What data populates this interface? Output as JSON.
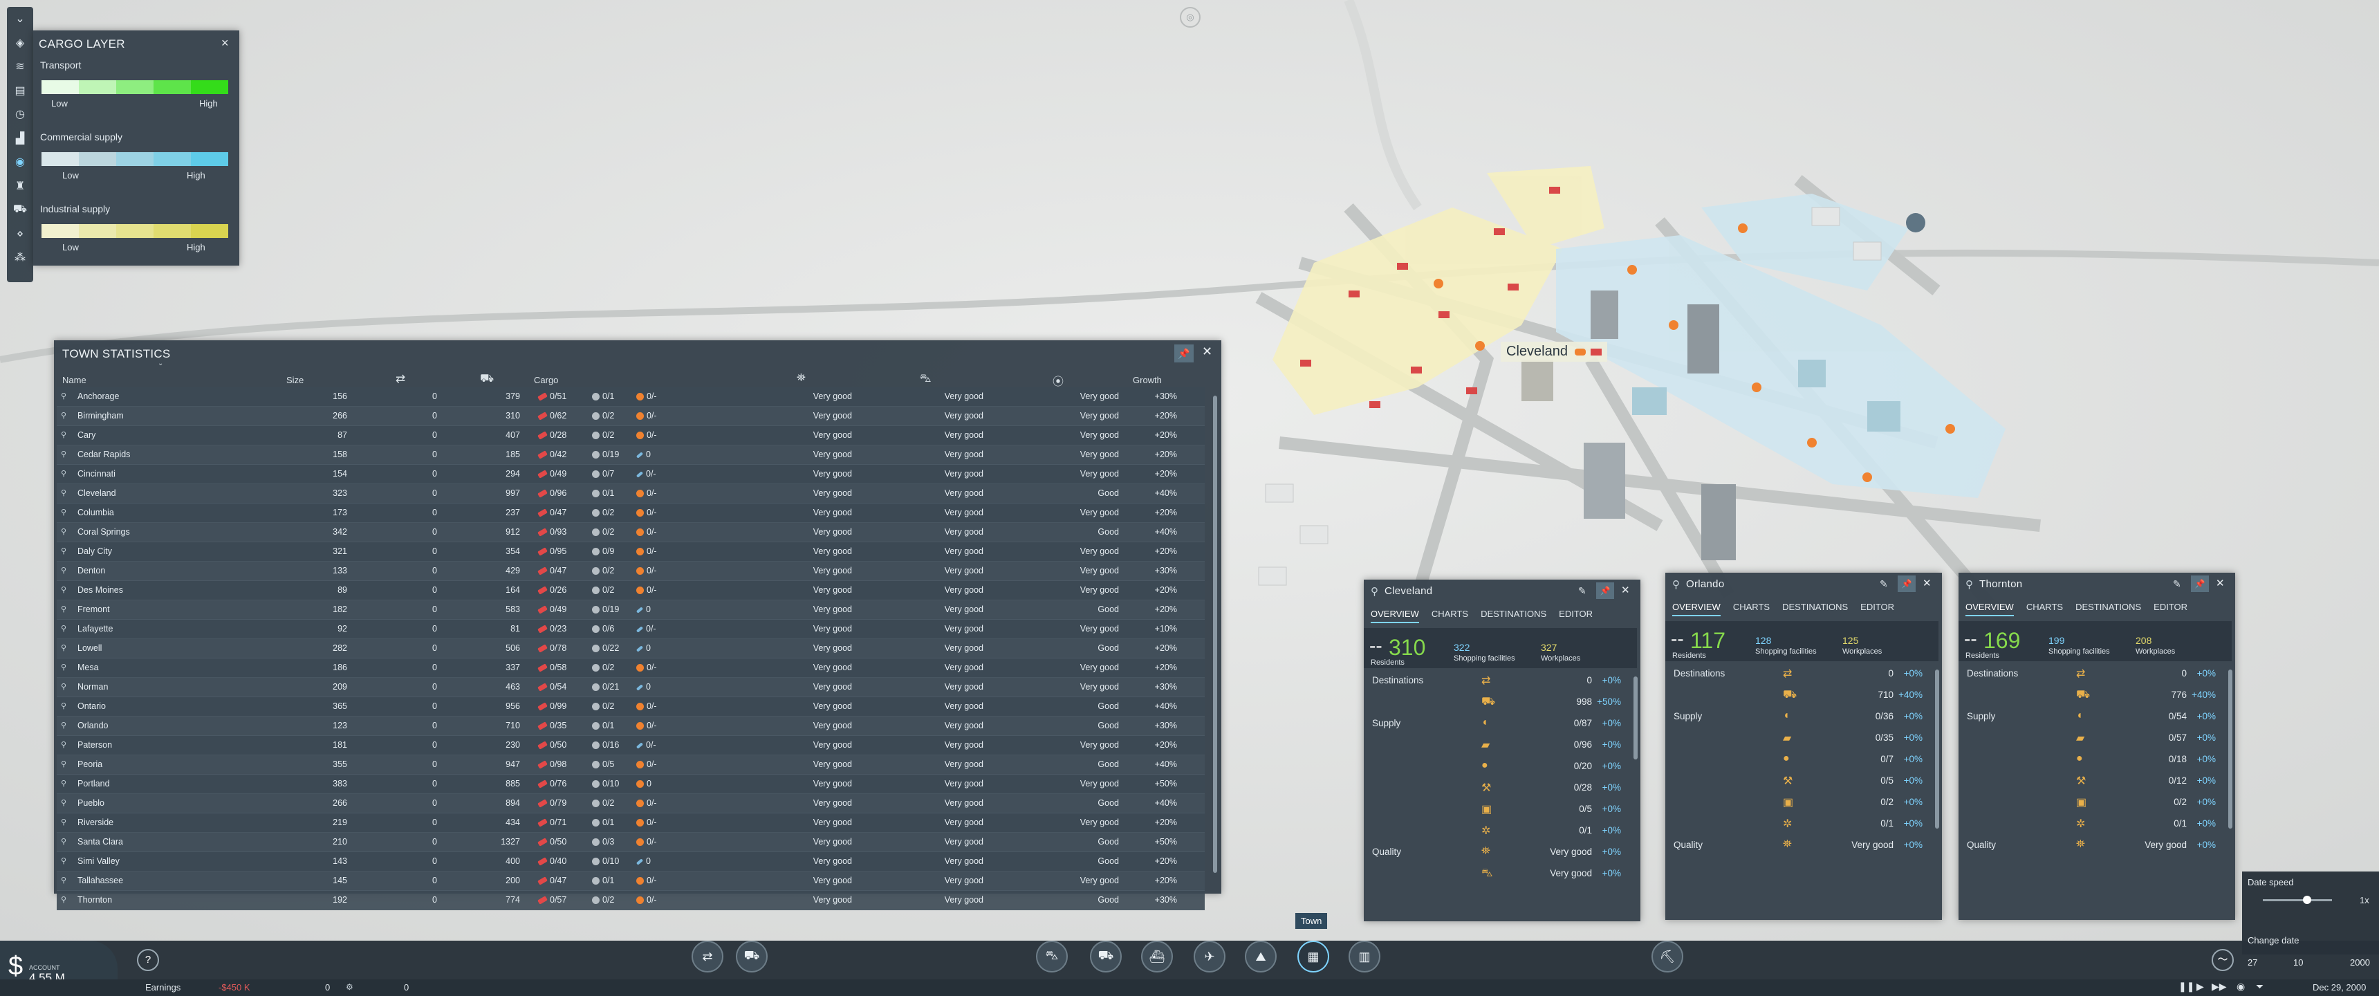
{
  "cargo_layer": {
    "title": "CARGO LAYER",
    "close": "×",
    "sections": [
      {
        "label": "Transport",
        "low": "Low",
        "high": "High",
        "colors": [
          "#e8fbe6",
          "#bff5b6",
          "#8eed80",
          "#5ee44a",
          "#34dc1a"
        ]
      },
      {
        "label": "Commercial supply",
        "low": "Low",
        "high": "High",
        "colors": [
          "#d9e6ea",
          "#bcd6de",
          "#9dd3e3",
          "#7fd0e6",
          "#5ecbe8"
        ]
      },
      {
        "label": "Industrial supply",
        "low": "Low",
        "high": "High",
        "colors": [
          "#f2f1cf",
          "#ebe9ad",
          "#e6e38f",
          "#e0dc70",
          "#d9d450"
        ]
      }
    ]
  },
  "town_stats": {
    "title": "TOWN STATISTICS",
    "columns": {
      "name": "Name",
      "size": "Size",
      "cargo": "Cargo",
      "growth": "Growth"
    },
    "rows": [
      {
        "name": "Anchorage",
        "size": "156",
        "a": "0",
        "b": "379",
        "c1": "0/51",
        "c2": "0/1",
        "c3": "0/-",
        "icon3": "orange",
        "q1": "Very good",
        "q2": "Very good",
        "q3": "Very good",
        "growth": "+30%"
      },
      {
        "name": "Birmingham",
        "size": "266",
        "a": "0",
        "b": "310",
        "c1": "0/62",
        "c2": "0/2",
        "c3": "0/-",
        "icon3": "orange",
        "q1": "Very good",
        "q2": "Very good",
        "q3": "Very good",
        "growth": "+20%"
      },
      {
        "name": "Cary",
        "size": "87",
        "a": "0",
        "b": "407",
        "c1": "0/28",
        "c2": "0/2",
        "c3": "0/-",
        "icon3": "orange",
        "q1": "Very good",
        "q2": "Very good",
        "q3": "Very good",
        "growth": "+20%"
      },
      {
        "name": "Cedar Rapids",
        "size": "158",
        "a": "0",
        "b": "185",
        "c1": "0/42",
        "c2": "0/19",
        "c3": "0",
        "icon3": "tool",
        "q1": "Very good",
        "q2": "Very good",
        "q3": "Very good",
        "growth": "+20%"
      },
      {
        "name": "Cincinnati",
        "size": "154",
        "a": "0",
        "b": "294",
        "c1": "0/49",
        "c2": "0/7",
        "c3": "0/-",
        "icon3": "tool",
        "q1": "Very good",
        "q2": "Very good",
        "q3": "Very good",
        "growth": "+20%"
      },
      {
        "name": "Cleveland",
        "size": "323",
        "a": "0",
        "b": "997",
        "c1": "0/96",
        "c2": "0/1",
        "c3": "0/-",
        "icon3": "orange",
        "q1": "Very good",
        "q2": "Very good",
        "q3": "Good",
        "growth": "+40%"
      },
      {
        "name": "Columbia",
        "size": "173",
        "a": "0",
        "b": "237",
        "c1": "0/47",
        "c2": "0/2",
        "c3": "0/-",
        "icon3": "orange",
        "q1": "Very good",
        "q2": "Very good",
        "q3": "Very good",
        "growth": "+20%"
      },
      {
        "name": "Coral Springs",
        "size": "342",
        "a": "0",
        "b": "912",
        "c1": "0/93",
        "c2": "0/2",
        "c3": "0/-",
        "icon3": "orange",
        "q1": "Very good",
        "q2": "Very good",
        "q3": "Good",
        "growth": "+40%"
      },
      {
        "name": "Daly City",
        "size": "321",
        "a": "0",
        "b": "354",
        "c1": "0/95",
        "c2": "0/9",
        "c3": "0/-",
        "icon3": "orange",
        "q1": "Very good",
        "q2": "Very good",
        "q3": "Very good",
        "growth": "+20%"
      },
      {
        "name": "Denton",
        "size": "133",
        "a": "0",
        "b": "429",
        "c1": "0/47",
        "c2": "0/2",
        "c3": "0/-",
        "icon3": "orange",
        "q1": "Very good",
        "q2": "Very good",
        "q3": "Very good",
        "growth": "+30%"
      },
      {
        "name": "Des Moines",
        "size": "89",
        "a": "0",
        "b": "164",
        "c1": "0/26",
        "c2": "0/2",
        "c3": "0/-",
        "icon3": "orange",
        "q1": "Very good",
        "q2": "Very good",
        "q3": "Very good",
        "growth": "+20%"
      },
      {
        "name": "Fremont",
        "size": "182",
        "a": "0",
        "b": "583",
        "c1": "0/49",
        "c2": "0/19",
        "c3": "0",
        "icon3": "tool",
        "q1": "Very good",
        "q2": "Very good",
        "q3": "Good",
        "growth": "+20%"
      },
      {
        "name": "Lafayette",
        "size": "92",
        "a": "0",
        "b": "81",
        "c1": "0/23",
        "c2": "0/6",
        "c3": "0/-",
        "icon3": "tool",
        "q1": "Very good",
        "q2": "Very good",
        "q3": "Very good",
        "growth": "+10%"
      },
      {
        "name": "Lowell",
        "size": "282",
        "a": "0",
        "b": "506",
        "c1": "0/78",
        "c2": "0/22",
        "c3": "0",
        "icon3": "tool",
        "q1": "Very good",
        "q2": "Very good",
        "q3": "Good",
        "growth": "+20%"
      },
      {
        "name": "Mesa",
        "size": "186",
        "a": "0",
        "b": "337",
        "c1": "0/58",
        "c2": "0/2",
        "c3": "0/-",
        "icon3": "orange",
        "q1": "Very good",
        "q2": "Very good",
        "q3": "Very good",
        "growth": "+20%"
      },
      {
        "name": "Norman",
        "size": "209",
        "a": "0",
        "b": "463",
        "c1": "0/54",
        "c2": "0/21",
        "c3": "0",
        "icon3": "tool",
        "q1": "Very good",
        "q2": "Very good",
        "q3": "Very good",
        "growth": "+30%"
      },
      {
        "name": "Ontario",
        "size": "365",
        "a": "0",
        "b": "956",
        "c1": "0/99",
        "c2": "0/2",
        "c3": "0/-",
        "icon3": "orange",
        "q1": "Very good",
        "q2": "Very good",
        "q3": "Good",
        "growth": "+40%"
      },
      {
        "name": "Orlando",
        "size": "123",
        "a": "0",
        "b": "710",
        "c1": "0/35",
        "c2": "0/1",
        "c3": "0/-",
        "icon3": "orange",
        "q1": "Very good",
        "q2": "Very good",
        "q3": "Good",
        "growth": "+30%"
      },
      {
        "name": "Paterson",
        "size": "181",
        "a": "0",
        "b": "230",
        "c1": "0/50",
        "c2": "0/16",
        "c3": "0/-",
        "icon3": "tool",
        "q1": "Very good",
        "q2": "Very good",
        "q3": "Very good",
        "growth": "+20%"
      },
      {
        "name": "Peoria",
        "size": "355",
        "a": "0",
        "b": "947",
        "c1": "0/98",
        "c2": "0/5",
        "c3": "0/-",
        "icon3": "orange",
        "q1": "Very good",
        "q2": "Very good",
        "q3": "Good",
        "growth": "+40%"
      },
      {
        "name": "Portland",
        "size": "383",
        "a": "0",
        "b": "885",
        "c1": "0/76",
        "c2": "0/10",
        "c3": "0",
        "icon3": "orange",
        "q1": "Very good",
        "q2": "Very good",
        "q3": "Very good",
        "growth": "+50%"
      },
      {
        "name": "Pueblo",
        "size": "266",
        "a": "0",
        "b": "894",
        "c1": "0/79",
        "c2": "0/2",
        "c3": "0/-",
        "icon3": "orange",
        "q1": "Very good",
        "q2": "Very good",
        "q3": "Good",
        "growth": "+40%"
      },
      {
        "name": "Riverside",
        "size": "219",
        "a": "0",
        "b": "434",
        "c1": "0/71",
        "c2": "0/1",
        "c3": "0/-",
        "icon3": "orange",
        "q1": "Very good",
        "q2": "Very good",
        "q3": "Very good",
        "growth": "+20%"
      },
      {
        "name": "Santa Clara",
        "size": "210",
        "a": "0",
        "b": "1327",
        "c1": "0/50",
        "c2": "0/3",
        "c3": "0/-",
        "icon3": "orange",
        "q1": "Very good",
        "q2": "Very good",
        "q3": "Good",
        "growth": "+50%"
      },
      {
        "name": "Simi Valley",
        "size": "143",
        "a": "0",
        "b": "400",
        "c1": "0/40",
        "c2": "0/10",
        "c3": "0",
        "icon3": "tool",
        "q1": "Very good",
        "q2": "Very good",
        "q3": "Good",
        "growth": "+20%"
      },
      {
        "name": "Tallahassee",
        "size": "145",
        "a": "0",
        "b": "200",
        "c1": "0/47",
        "c2": "0/1",
        "c3": "0/-",
        "icon3": "orange",
        "q1": "Very good",
        "q2": "Very good",
        "q3": "Very good",
        "growth": "+20%"
      },
      {
        "name": "Thornton",
        "size": "192",
        "a": "0",
        "b": "774",
        "c1": "0/57",
        "c2": "0/2",
        "c3": "0/-",
        "icon3": "orange",
        "q1": "Very good",
        "q2": "Very good",
        "q3": "Good",
        "growth": "+30%"
      }
    ]
  },
  "map_label": "Cleveland",
  "town_windows": [
    {
      "title": "Cleveland",
      "tabs": [
        "OVERVIEW",
        "CHARTS",
        "DESTINATIONS",
        "EDITOR"
      ],
      "dash": "--",
      "residents": "310",
      "residents_label": "Residents",
      "shopping": "322",
      "shopping_label": "Shopping facilities",
      "workplaces": "327",
      "workplaces_label": "Workplaces",
      "lines": [
        {
          "label": "Destinations",
          "val": "0",
          "pct": "+0%"
        },
        {
          "label": "",
          "val": "998",
          "pct": "+50%"
        },
        {
          "label": "Supply",
          "val": "0/87",
          "pct": "+0%"
        },
        {
          "label": "",
          "val": "0/96",
          "pct": "+0%"
        },
        {
          "label": "",
          "val": "0/20",
          "pct": "+0%"
        },
        {
          "label": "",
          "val": "0/28",
          "pct": "+0%"
        },
        {
          "label": "",
          "val": "0/5",
          "pct": "+0%"
        },
        {
          "label": "",
          "val": "0/1",
          "pct": "+0%"
        },
        {
          "label": "Quality",
          "val": "Very good",
          "pct": "+0%"
        },
        {
          "label": "",
          "val": "Very good",
          "pct": "+0%"
        }
      ]
    },
    {
      "title": "Orlando",
      "tabs": [
        "OVERVIEW",
        "CHARTS",
        "DESTINATIONS",
        "EDITOR"
      ],
      "dash": "--",
      "residents": "117",
      "residents_label": "Residents",
      "shopping": "128",
      "shopping_label": "Shopping facilities",
      "workplaces": "125",
      "workplaces_label": "Workplaces",
      "lines": [
        {
          "label": "Destinations",
          "val": "0",
          "pct": "+0%"
        },
        {
          "label": "",
          "val": "710",
          "pct": "+40%"
        },
        {
          "label": "Supply",
          "val": "0/36",
          "pct": "+0%"
        },
        {
          "label": "",
          "val": "0/35",
          "pct": "+0%"
        },
        {
          "label": "",
          "val": "0/7",
          "pct": "+0%"
        },
        {
          "label": "",
          "val": "0/5",
          "pct": "+0%"
        },
        {
          "label": "",
          "val": "0/2",
          "pct": "+0%"
        },
        {
          "label": "",
          "val": "0/1",
          "pct": "+0%"
        },
        {
          "label": "Quality",
          "val": "Very good",
          "pct": "+0%"
        }
      ]
    },
    {
      "title": "Thornton",
      "tabs": [
        "OVERVIEW",
        "CHARTS",
        "DESTINATIONS",
        "EDITOR"
      ],
      "dash": "--",
      "residents": "169",
      "residents_label": "Residents",
      "shopping": "199",
      "shopping_label": "Shopping facilities",
      "workplaces": "208",
      "workplaces_label": "Workplaces",
      "lines": [
        {
          "label": "Destinations",
          "val": "0",
          "pct": "+0%"
        },
        {
          "label": "",
          "val": "776",
          "pct": "+40%"
        },
        {
          "label": "Supply",
          "val": "0/54",
          "pct": "+0%"
        },
        {
          "label": "",
          "val": "0/57",
          "pct": "+0%"
        },
        {
          "label": "",
          "val": "0/18",
          "pct": "+0%"
        },
        {
          "label": "",
          "val": "0/12",
          "pct": "+0%"
        },
        {
          "label": "",
          "val": "0/2",
          "pct": "+0%"
        },
        {
          "label": "",
          "val": "0/1",
          "pct": "+0%"
        },
        {
          "label": "Quality",
          "val": "Very good",
          "pct": "+0%"
        }
      ]
    }
  ],
  "bottom": {
    "account_label": "ACCOUNT",
    "account_value": "4.55 M",
    "help": "?",
    "earnings_label": "Earnings",
    "earnings_value": "-$450 K",
    "zero1": "0",
    "zero2": "0",
    "town_tooltip": "Town",
    "date_speed_label": "Date speed",
    "speed_value": "1x",
    "change_date_label": "Change date",
    "day": "27",
    "month": "10",
    "year": "2000",
    "date_display": "Dec 29, 2000",
    "accent": "#7fd4ff",
    "negative": "#e05a5a",
    "positive": "#86d94c"
  }
}
